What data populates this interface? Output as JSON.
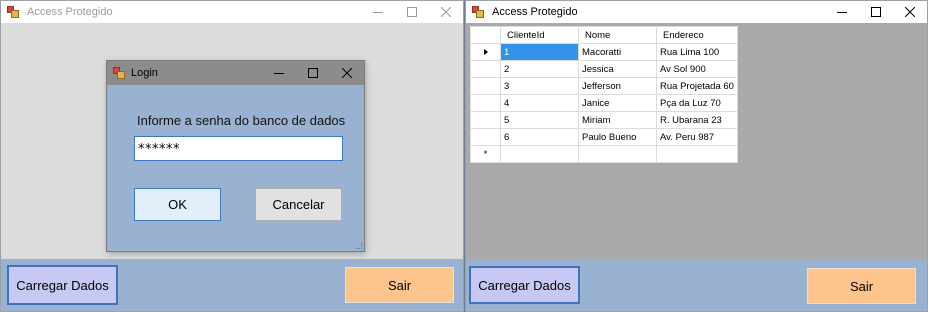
{
  "window1": {
    "title": "Access Protegido",
    "load_button": "Carregar Dados",
    "exit_button": "Sair",
    "login_dialog": {
      "title": "Login",
      "prompt": "Informe a senha do banco de dados",
      "password_value": "******",
      "ok_button": "OK",
      "cancel_button": "Cancelar"
    }
  },
  "window2": {
    "title": "Access Protegido",
    "load_button": "Carregar Dados",
    "exit_button": "Sair",
    "grid": {
      "columns": [
        "ClienteId",
        "Nome",
        "Endereco"
      ],
      "rows": [
        [
          "1",
          "Macoratti",
          "Rua Lima 100"
        ],
        [
          "2",
          "Jessica",
          "Av Sol 900"
        ],
        [
          "3",
          "Jefferson",
          "Rua Projetada 60"
        ],
        [
          "4",
          "Janice",
          "Pça da Luz 70"
        ],
        [
          "5",
          "Miriam",
          "R. Ubarana 23"
        ],
        [
          "6",
          "Paulo Bueno",
          "Av. Peru 987"
        ]
      ],
      "current_row_marker": "arrow",
      "new_row_marker": "*"
    }
  },
  "colors": {
    "bottom_bar": "#9ab2d2",
    "load_button_bg": "#c8c8f4",
    "exit_button_bg": "#fdc48d",
    "selected_cell": "#3393e8"
  },
  "icons": {
    "app": "access-app-icon",
    "minimize": "minimize-icon",
    "maximize": "maximize-icon",
    "close": "close-icon"
  }
}
